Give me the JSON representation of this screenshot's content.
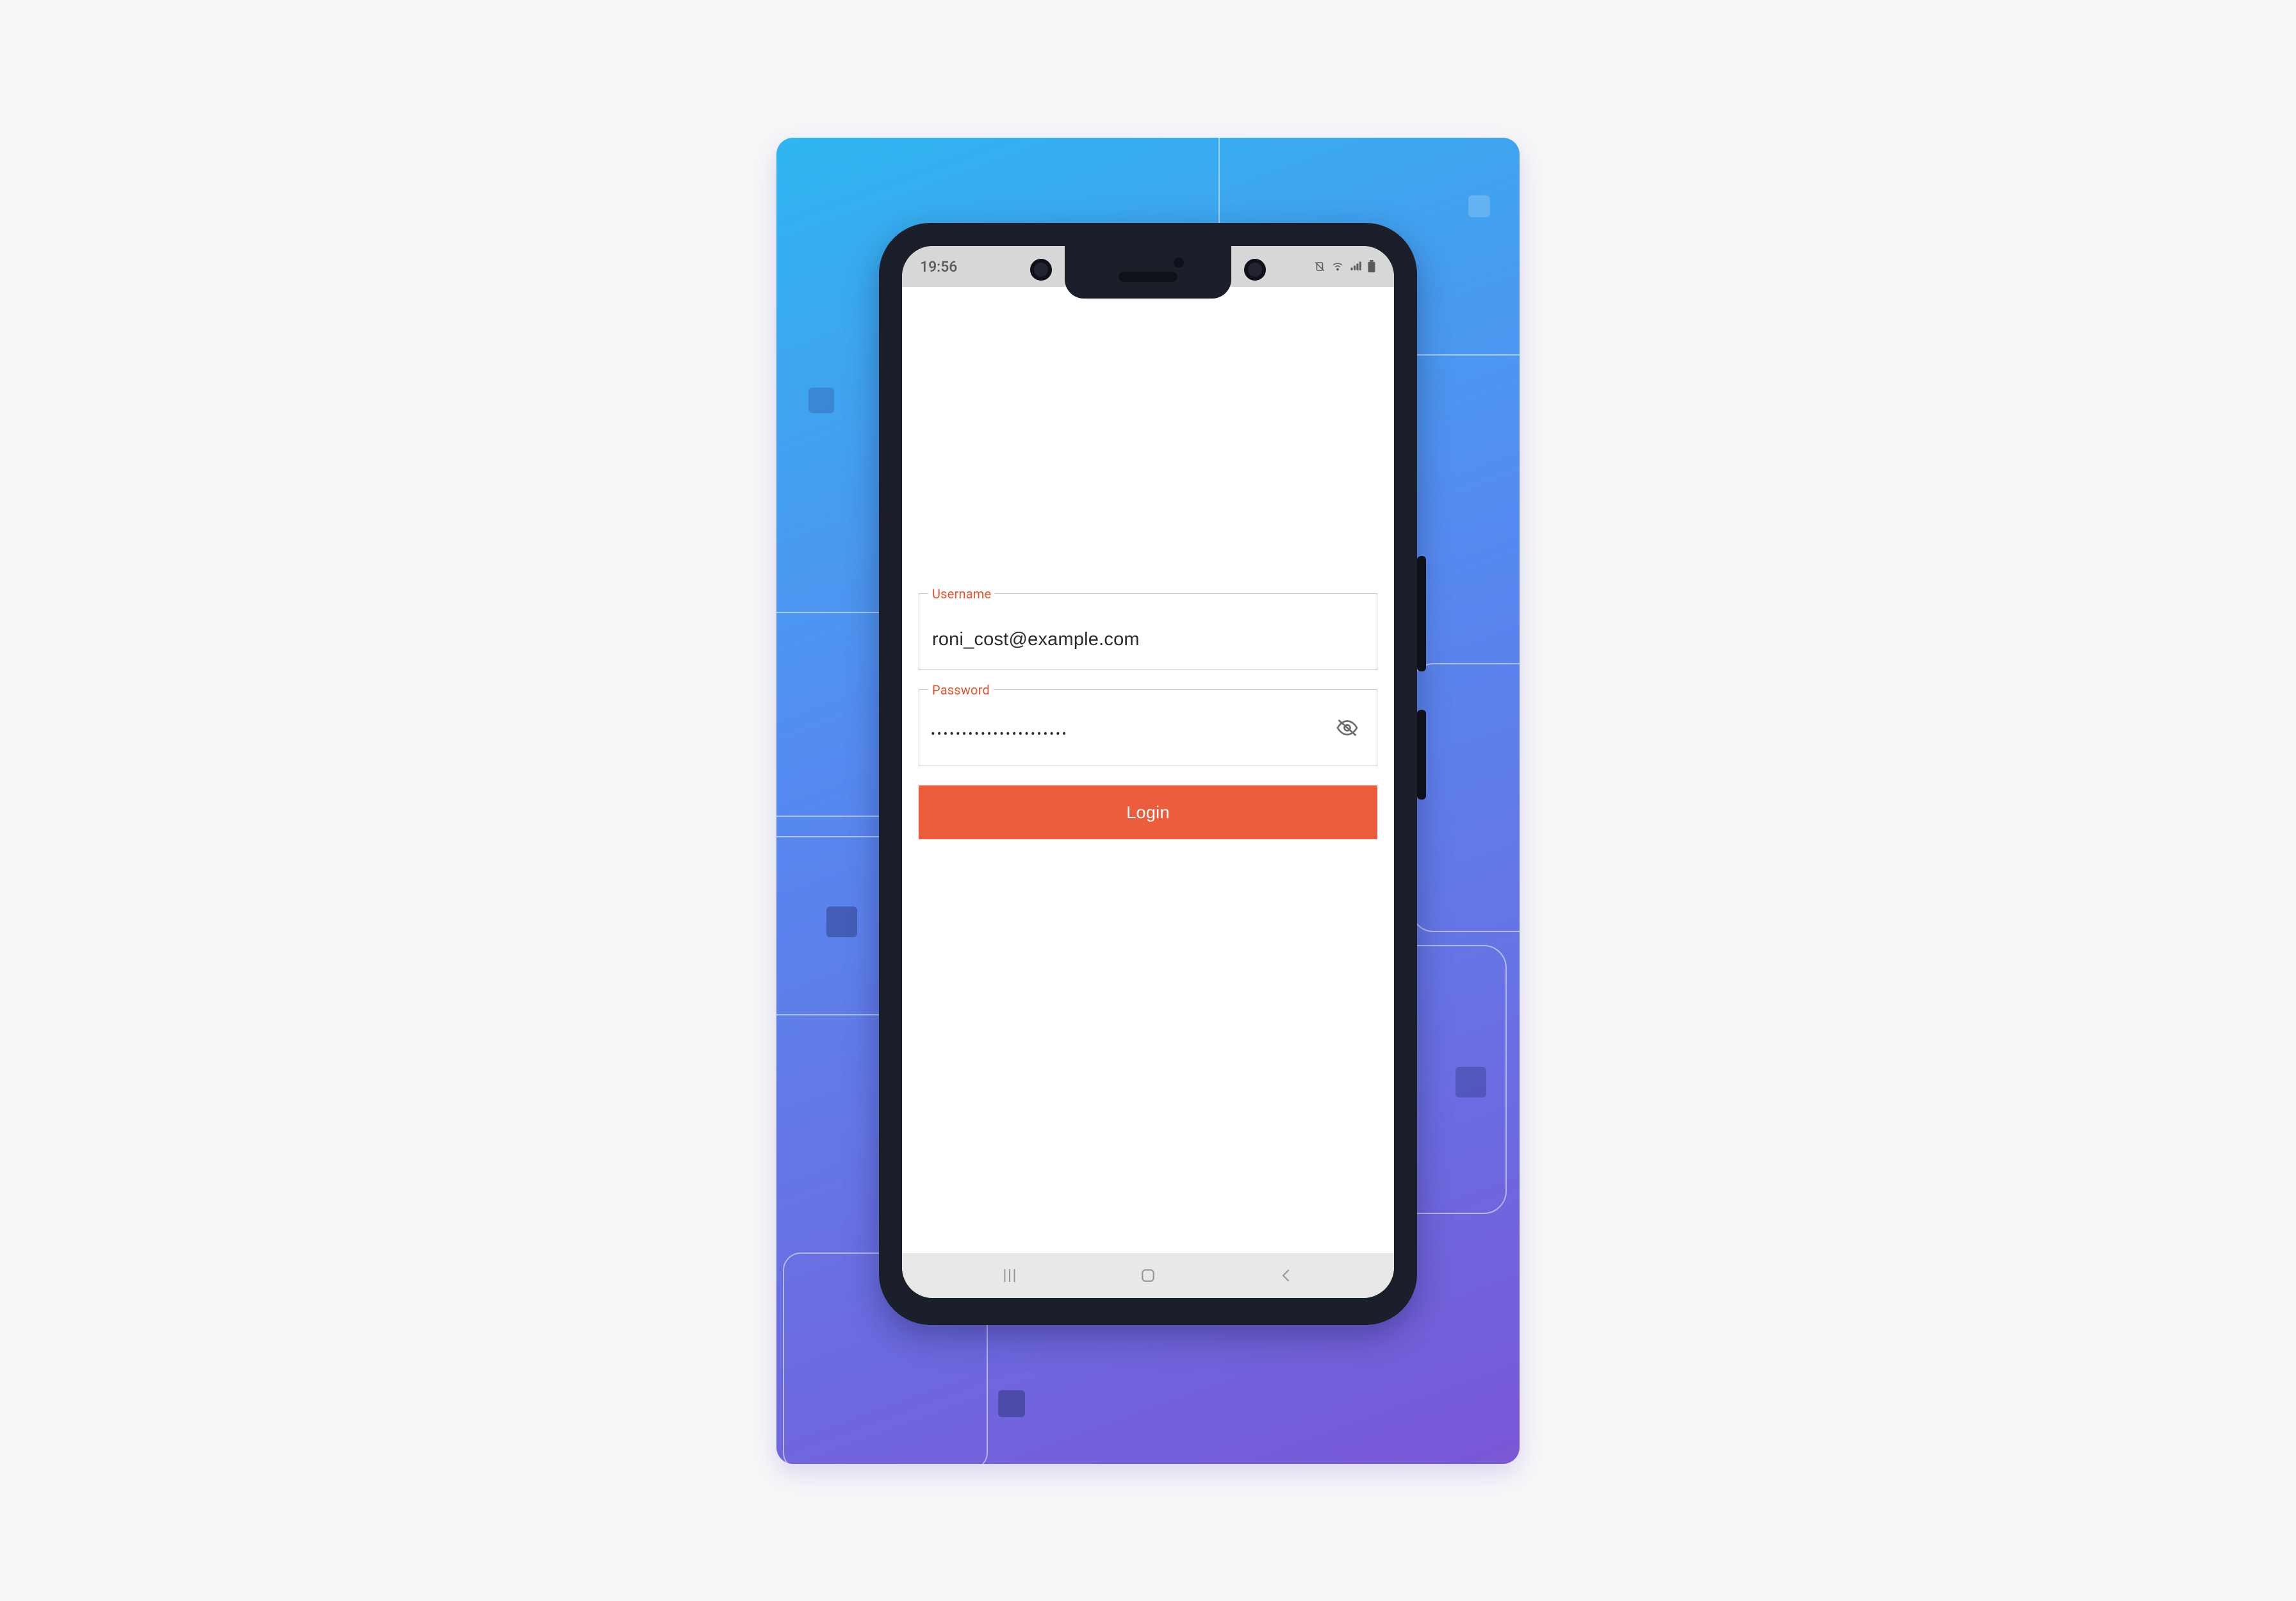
{
  "statusbar": {
    "time": "19:56"
  },
  "form": {
    "username": {
      "label": "Username",
      "value": "roni_cost@example.com"
    },
    "password": {
      "label": "Password",
      "value_masked": "••••••••••••••••••••••"
    },
    "login_label": "Login"
  },
  "colors": {
    "accent": "#ec5c3d",
    "label": "#e7522f",
    "gradient_from": "#2fb6f0",
    "gradient_to": "#7a57d6"
  }
}
